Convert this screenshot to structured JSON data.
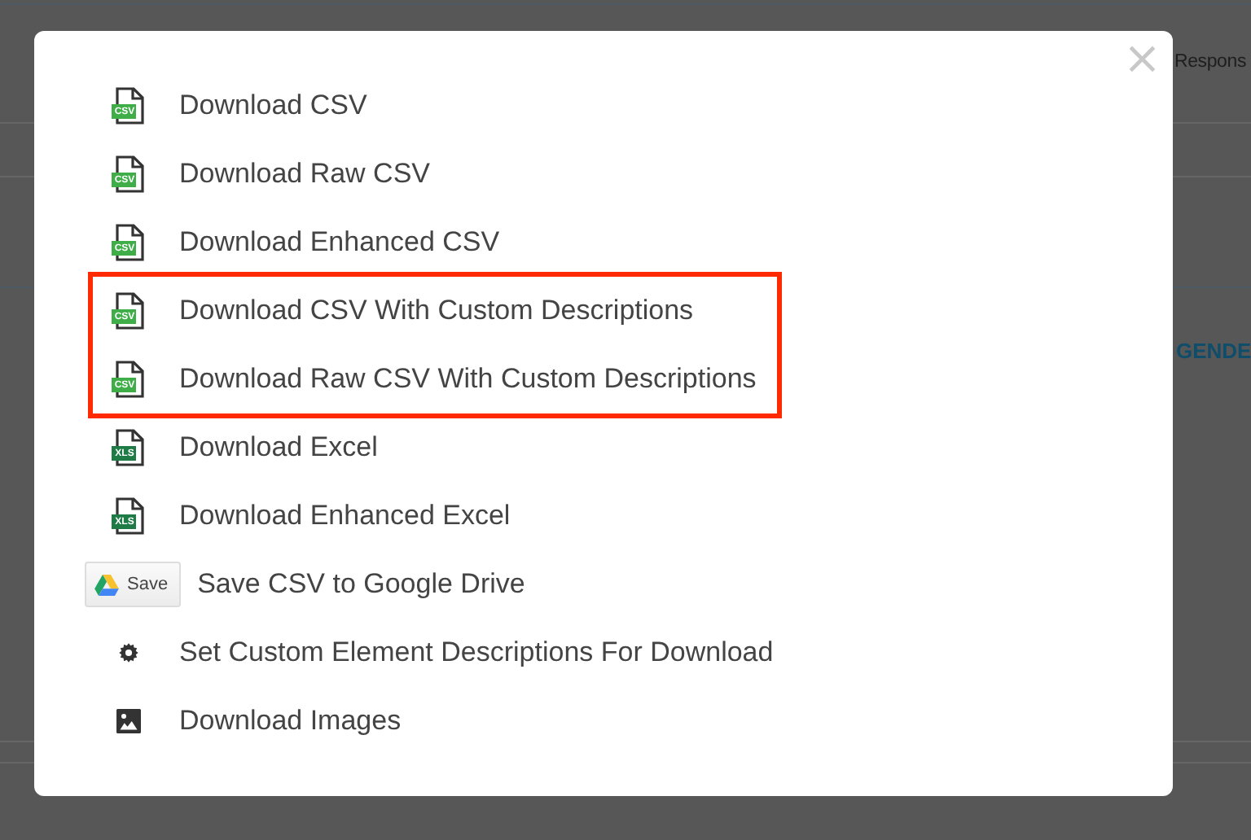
{
  "background": {
    "header_text": "Respons",
    "column_link": "GENDE"
  },
  "dialog": {
    "close": "×",
    "items": [
      {
        "kind": "csv",
        "badge": "CSV",
        "label": "Download CSV",
        "highlighted": false
      },
      {
        "kind": "csv",
        "badge": "CSV",
        "label": "Download Raw CSV",
        "highlighted": false
      },
      {
        "kind": "csv",
        "badge": "CSV",
        "label": "Download Enhanced CSV",
        "highlighted": false
      },
      {
        "kind": "csv",
        "badge": "CSV",
        "label": "Download CSV With Custom Descriptions",
        "highlighted": true
      },
      {
        "kind": "csv",
        "badge": "CSV",
        "label": "Download Raw CSV With Custom Descriptions",
        "highlighted": true
      },
      {
        "kind": "xls",
        "badge": "XLS",
        "label": "Download Excel",
        "highlighted": false
      },
      {
        "kind": "xls",
        "badge": "XLS",
        "label": "Download Enhanced Excel",
        "highlighted": false
      },
      {
        "kind": "drive",
        "badge": "Save",
        "label": "Save CSV to Google Drive",
        "highlighted": false
      },
      {
        "kind": "gear",
        "label": "Set Custom Element Descriptions For Download",
        "highlighted": false
      },
      {
        "kind": "image",
        "label": "Download Images",
        "highlighted": false
      }
    ]
  }
}
